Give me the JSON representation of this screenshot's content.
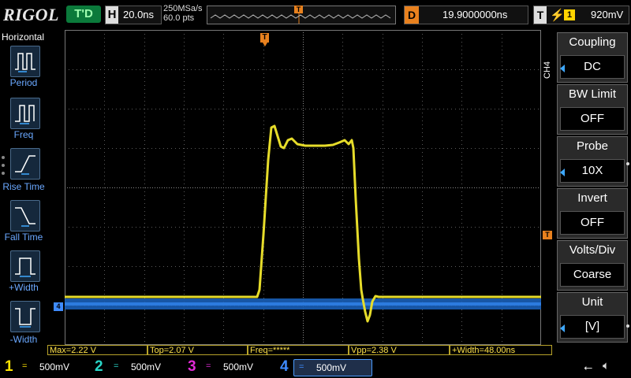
{
  "brand": "RIGOL",
  "topbar": {
    "trigger_status": "T'D",
    "h_label": "H",
    "timebase": "20.0ns",
    "sample_rate": "250MSa/s",
    "memory_depth": "60.0  pts",
    "d_label": "D",
    "delay": "19.9000000ns",
    "t_label": "T",
    "trigger_edge_icon": "rising-edge-icon",
    "trigger_source": "1",
    "trigger_level": "920mV"
  },
  "left_menu": {
    "title": "Horizontal",
    "items": [
      {
        "label": "Period",
        "icon": "period-icon"
      },
      {
        "label": "Freq",
        "icon": "freq-icon"
      },
      {
        "label": "Rise Time",
        "icon": "rise-time-icon"
      },
      {
        "label": "Fall Time",
        "icon": "fall-time-icon"
      },
      {
        "label": "+Width",
        "icon": "positive-width-icon"
      },
      {
        "label": "-Width",
        "icon": "negative-width-icon"
      }
    ]
  },
  "right_menu": {
    "channel_tag": "CH4",
    "items": [
      {
        "title": "Coupling",
        "value": "DC"
      },
      {
        "title": "BW Limit",
        "value": "OFF"
      },
      {
        "title": "Probe",
        "value": "10X"
      },
      {
        "title": "Invert",
        "value": "OFF"
      },
      {
        "title": "Volts/Div",
        "value": "Coarse"
      },
      {
        "title": "Unit",
        "value": "[V]"
      }
    ]
  },
  "markers": {
    "trigger_pos_marker": "T",
    "ch4_ground_marker": "4",
    "trigger_level_marker": "T"
  },
  "measurements": [
    {
      "label": "Max=2.22 V"
    },
    {
      "label": "Top=2.07 V"
    },
    {
      "label": "Freq=*****"
    },
    {
      "label": "Vpp=2.38 V"
    },
    {
      "label": "+Width=48.00ns"
    }
  ],
  "channels": [
    {
      "num": "1",
      "coupling": "=",
      "scale": "500mV",
      "color": "#ffe400"
    },
    {
      "num": "2",
      "coupling": "=",
      "scale": "500mV",
      "color": "#29d6c8"
    },
    {
      "num": "3",
      "coupling": "=",
      "scale": "500mV",
      "color": "#e02bd6"
    },
    {
      "num": "4",
      "coupling": "=",
      "scale": "500mV",
      "color": "#3e8bff"
    }
  ],
  "colors": {
    "ch1_trace": "#ffe400",
    "ch4_trace": "#1c6fd6",
    "trigger_marker": "#e8811e",
    "menu_accent": "#3ea8ff"
  }
}
